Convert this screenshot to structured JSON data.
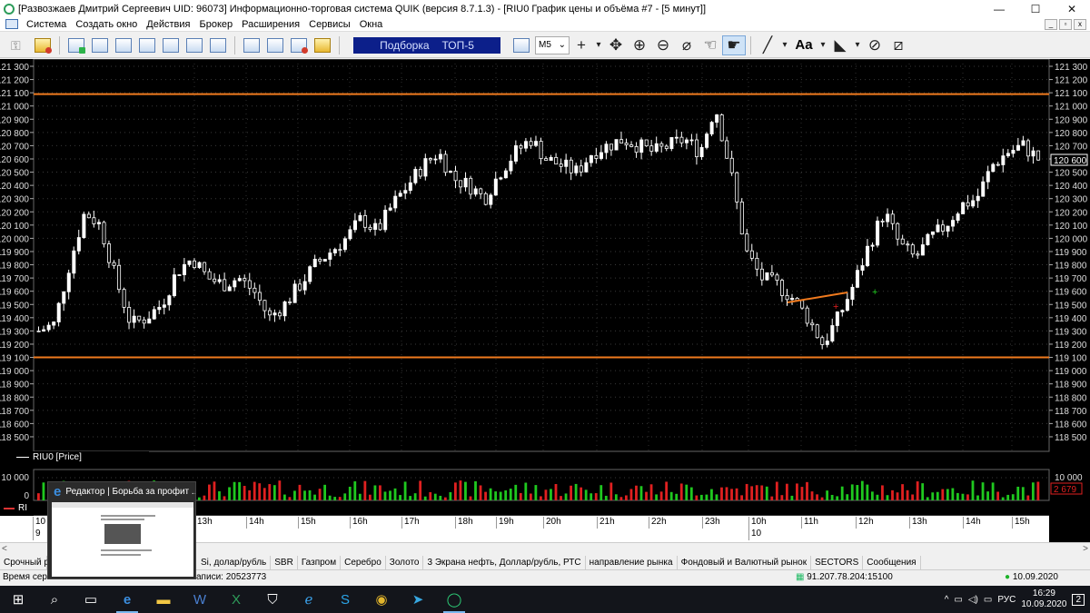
{
  "window": {
    "title": "[Развозжаев Дмитрий Сергеевич UID: 96073] Информационно-торговая система QUIK (версия 8.7.1.3) - [RIU0 График цены и объёма #7 - [5 минут]]",
    "min": "—",
    "max": "☐",
    "close": "✕"
  },
  "menu": [
    "Система",
    "Создать окно",
    "Действия",
    "Брокер",
    "Расширения",
    "Сервисы",
    "Окна"
  ],
  "mdi": [
    "_",
    "▫",
    "x"
  ],
  "toolbar": {
    "selector_label": "Подборка",
    "selector_value": "ТОП-5",
    "interval": "M5",
    "font_label": "Aa"
  },
  "chart": {
    "series_label": "RIU0 [Price]",
    "volume_label": "RI",
    "current_price_label": "120 600",
    "current_volume_label": "2 679",
    "volume_axis_top": "10 000",
    "volume_axis_zero": "0",
    "volume_axis_right": "10 000",
    "colors": {
      "up": "#ffffff",
      "down": "#ffffff",
      "vol_up": "#1fc81f",
      "vol_down": "#e02020",
      "level": "#f07a1e",
      "trend": "#f07a1e"
    }
  },
  "chart_data": {
    "type": "candlestick",
    "symbol": "RIU0",
    "timeframe": "5 минут",
    "y_ticks": [
      121300,
      121200,
      121100,
      121000,
      120900,
      120800,
      120700,
      120600,
      120500,
      120400,
      120300,
      120200,
      120100,
      120000,
      119900,
      119800,
      119700,
      119600,
      119500,
      119400,
      119300,
      119200,
      119100,
      119000,
      118900,
      118800,
      118700,
      118600,
      118500
    ],
    "y_tick_labels": [
      "121 300",
      "121 200",
      "121 100",
      "121 000",
      "120 900",
      "120 800",
      "120 700",
      "120 600",
      "120 500",
      "120 400",
      "120 300",
      "120 200",
      "120 100",
      "120 000",
      "119 900",
      "119 800",
      "119 700",
      "119 600",
      "119 500",
      "119 400",
      "119 300",
      "119 200",
      "119 100",
      "119 000",
      "118 900",
      "118 800",
      "118 700",
      "118 600",
      "118 500"
    ],
    "ylim": [
      118450,
      121350
    ],
    "horizontal_levels": [
      121090,
      119100
    ],
    "close_path": [
      119300,
      119350,
      119800,
      120200,
      120100,
      119700,
      119350,
      119400,
      119500,
      119750,
      119850,
      119700,
      119650,
      119700,
      119600,
      119400,
      119500,
      119650,
      119800,
      119900,
      120000,
      120150,
      120050,
      120250,
      120400,
      120550,
      120650,
      120450,
      120400,
      120300,
      120500,
      120650,
      120750,
      120600,
      120550,
      120500,
      120650,
      120700,
      120750,
      120700,
      120650,
      120700,
      120750,
      120650,
      121000,
      120500,
      119900,
      119700,
      119650,
      119550,
      119400,
      119200,
      119400,
      119650,
      119950,
      120200,
      119950,
      119850,
      120000,
      120100,
      120250,
      120300,
      120550,
      120650,
      120700,
      120600
    ],
    "time_labels": [
      "13h",
      "14h",
      "15h",
      "16h",
      "17h",
      "18h",
      "19h",
      "20h",
      "21h",
      "22h",
      "23h",
      "10h",
      "11h",
      "12h",
      "13h",
      "14h",
      "15h"
    ],
    "date_labels": [
      "10",
      "9",
      "10"
    ]
  },
  "time_axis_left": {
    "top": "10",
    "bottom": "9"
  },
  "tabs": [
    "Срочный р",
    "Si, долар/рубль",
    "SBR",
    "Газпром",
    "Серебро",
    "Золото",
    "3 Экрана нефть, Доллар/рубль, РТС",
    "направление рынка",
    "Фондовый и Валютный рынок",
    "SECTORS",
    "Сообщения"
  ],
  "status": {
    "time_label": "Время серв",
    "records": "аписи: 20523773",
    "server": "91.207.78.204:15100",
    "date": "10.09.2020"
  },
  "thumbnail": {
    "title": "Редактор | Борьба за профит ..."
  },
  "taskbar": {
    "lang": "РУС",
    "time": "16:29",
    "date": "10.09.2020",
    "notif": "2"
  }
}
